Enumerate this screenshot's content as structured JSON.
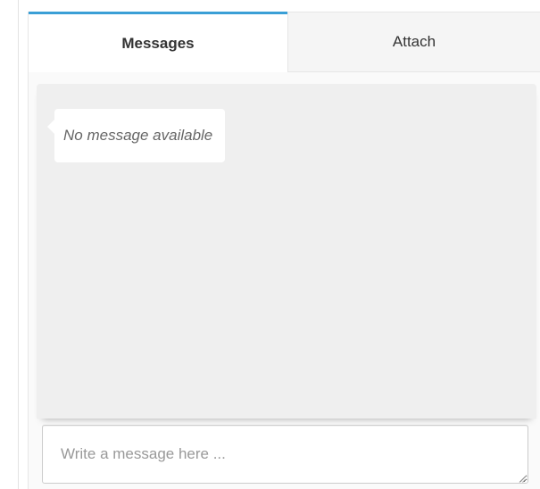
{
  "tabs": {
    "messages_label": "Messages",
    "attach_label": "Attach",
    "active": "Messages"
  },
  "messages": {
    "empty_text": "No message available"
  },
  "composer": {
    "placeholder": "Write a message here ...",
    "value": ""
  },
  "colors": {
    "active_tab_accent": "#3a9fd6",
    "content_background": "#efefef"
  },
  "icons": {
    "resize_grip": "resize-grip-icon"
  }
}
